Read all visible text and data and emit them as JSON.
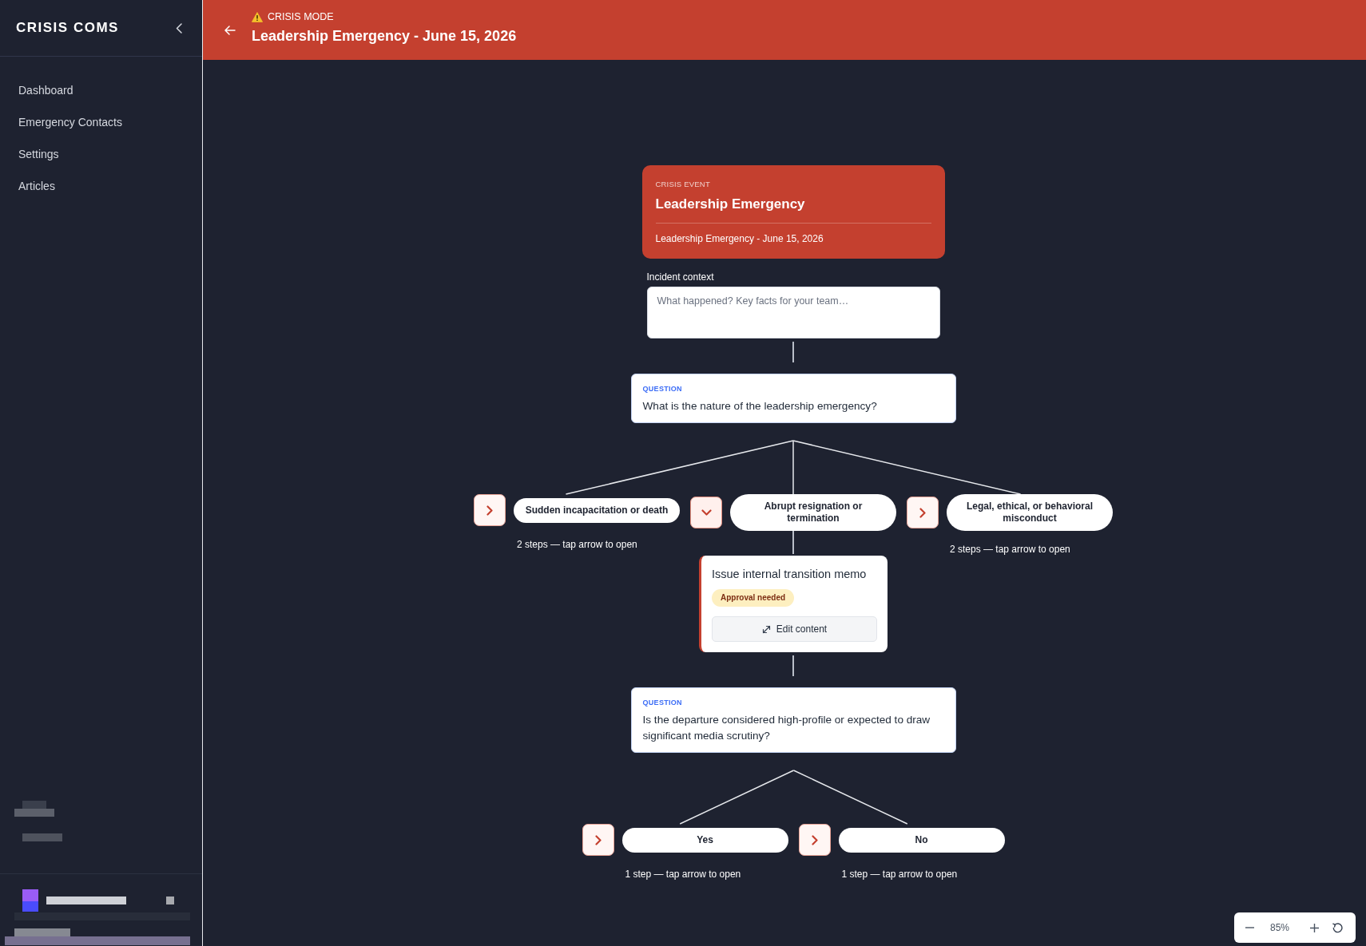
{
  "sidebar": {
    "logo": "CRISIS COMS",
    "items": [
      {
        "label": "Dashboard",
        "selected": false
      },
      {
        "label": "Emergency Contacts",
        "selected": false
      },
      {
        "label": "Settings",
        "selected": false
      },
      {
        "label": "Articles",
        "selected": false
      }
    ]
  },
  "header": {
    "mode_label": "CRISIS MODE",
    "title": "Leadership Emergency - June 15, 2026"
  },
  "event_card": {
    "eyebrow": "CRISIS EVENT",
    "title": "Leadership Emergency",
    "subtitle": "Leadership Emergency - June 15, 2026"
  },
  "incident_context": {
    "label": "Incident context",
    "placeholder": "What happened? Key facts for your team…"
  },
  "flow": [
    {
      "kind": "question",
      "eyebrow": "QUESTION",
      "text": "What is the nature of the leadership emergency?",
      "options": [
        {
          "label": "Sudden incapacitation or death",
          "expanded": false,
          "hint": "2 steps — tap arrow to open"
        },
        {
          "label": "Abrupt resignation or termination",
          "expanded": true,
          "children": [
            {
              "kind": "task",
              "title": "Issue internal transition memo",
              "badge": "Approval needed",
              "action": "Edit content"
            },
            {
              "kind": "question",
              "eyebrow": "QUESTION",
              "text": "Is the departure considered high-profile or expected to draw significant media scrutiny?",
              "options": [
                {
                  "label": "Yes",
                  "expanded": false,
                  "hint": "1 step — tap arrow to open"
                },
                {
                  "label": "No",
                  "expanded": false,
                  "hint": "1 step — tap arrow to open"
                }
              ]
            }
          ]
        },
        {
          "label": "Legal, ethical, or behavioral misconduct",
          "expanded": false,
          "hint": "2 steps — tap arrow to open"
        }
      ]
    }
  ],
  "zoom_control": {
    "value": "85%"
  }
}
